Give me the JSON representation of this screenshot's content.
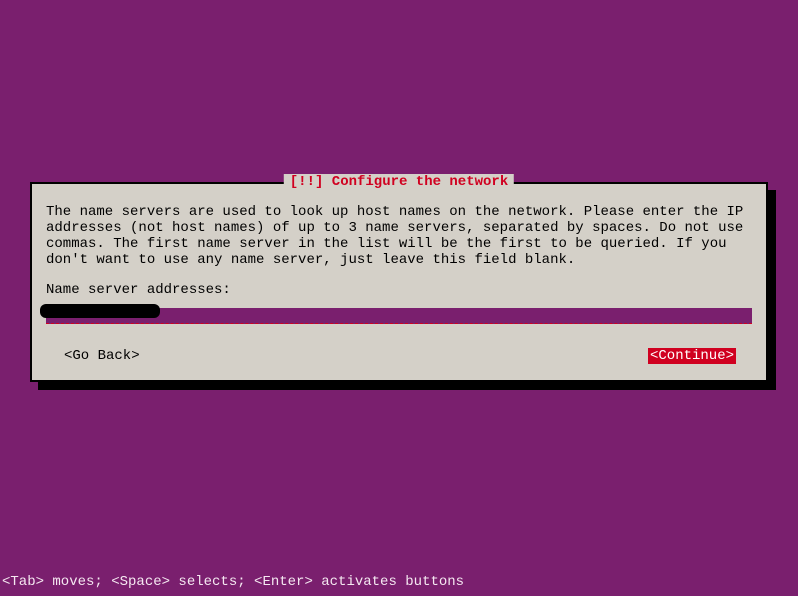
{
  "dialog": {
    "title": "[!!] Configure the network",
    "instructions": "The name servers are used to look up host names on the network. Please enter the IP addresses (not host names) of up to 3 name servers, separated by spaces. Do not use commas. The first name server in the list will be the first to be queried. If you don't want to use any name server, just leave this field blank.",
    "prompt_label": "Name server addresses:",
    "input_value": "",
    "buttons": {
      "go_back": "<Go Back>",
      "continue": "<Continue>"
    },
    "selected_button": "continue"
  },
  "footer": "<Tab> moves; <Space> selects; <Enter> activates buttons"
}
